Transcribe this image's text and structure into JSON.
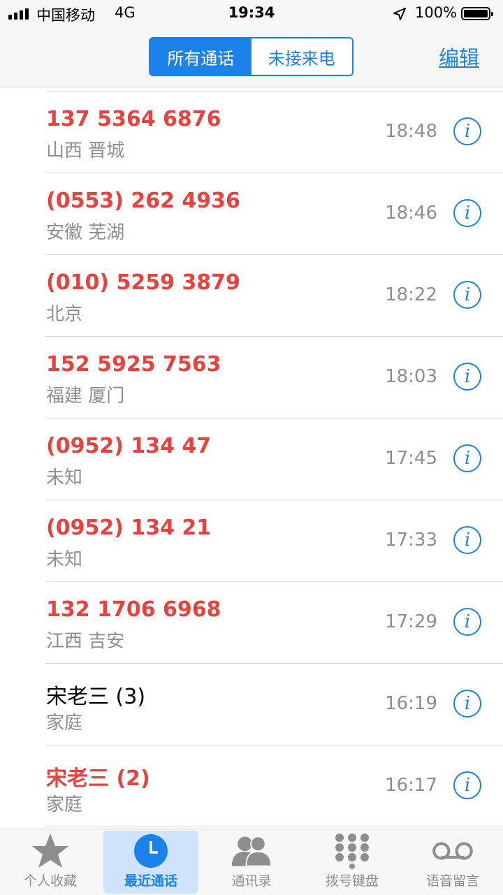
{
  "status": {
    "carrier": "中国移动",
    "network": "4G",
    "time": "19:34",
    "battery": "100%",
    "signal_bars": 4
  },
  "nav": {
    "segment_all": "所有通话",
    "segment_missed": "未接来电",
    "edit": "编辑"
  },
  "calls": [
    {
      "name": "137 5364 6876",
      "subtitle": "山西 晋城",
      "time": "18:48",
      "missed": true
    },
    {
      "name": "(0553) 262 4936",
      "subtitle": "安徽 芜湖",
      "time": "18:46",
      "missed": true
    },
    {
      "name": "(010) 5259 3879",
      "subtitle": "北京",
      "time": "18:22",
      "missed": true
    },
    {
      "name": "152 5925 7563",
      "subtitle": "福建 厦门",
      "time": "18:03",
      "missed": true
    },
    {
      "name": "(0952) 134 47",
      "subtitle": "未知",
      "time": "17:45",
      "missed": true
    },
    {
      "name": "(0952) 134 21",
      "subtitle": "未知",
      "time": "17:33",
      "missed": true
    },
    {
      "name": "132 1706 6968",
      "subtitle": "江西 吉安",
      "time": "17:29",
      "missed": true
    },
    {
      "name": "宋老三 (3)",
      "subtitle": "家庭",
      "time": "16:19",
      "missed": false
    },
    {
      "name": "宋老三 (2)",
      "subtitle": "家庭",
      "time": "16:17",
      "missed": true
    }
  ],
  "tabs": [
    {
      "label": "个人收藏",
      "icon": "star-icon",
      "active": false
    },
    {
      "label": "最近通话",
      "icon": "clock-icon",
      "active": true
    },
    {
      "label": "通讯录",
      "icon": "contacts-icon",
      "active": false
    },
    {
      "label": "拨号键盘",
      "icon": "keypad-icon",
      "active": false
    },
    {
      "label": "语音留言",
      "icon": "voicemail-icon",
      "active": false
    }
  ],
  "colors": {
    "accent": "#1a82e8",
    "missed": "#e8423f",
    "secondary": "#8e8e8e"
  }
}
